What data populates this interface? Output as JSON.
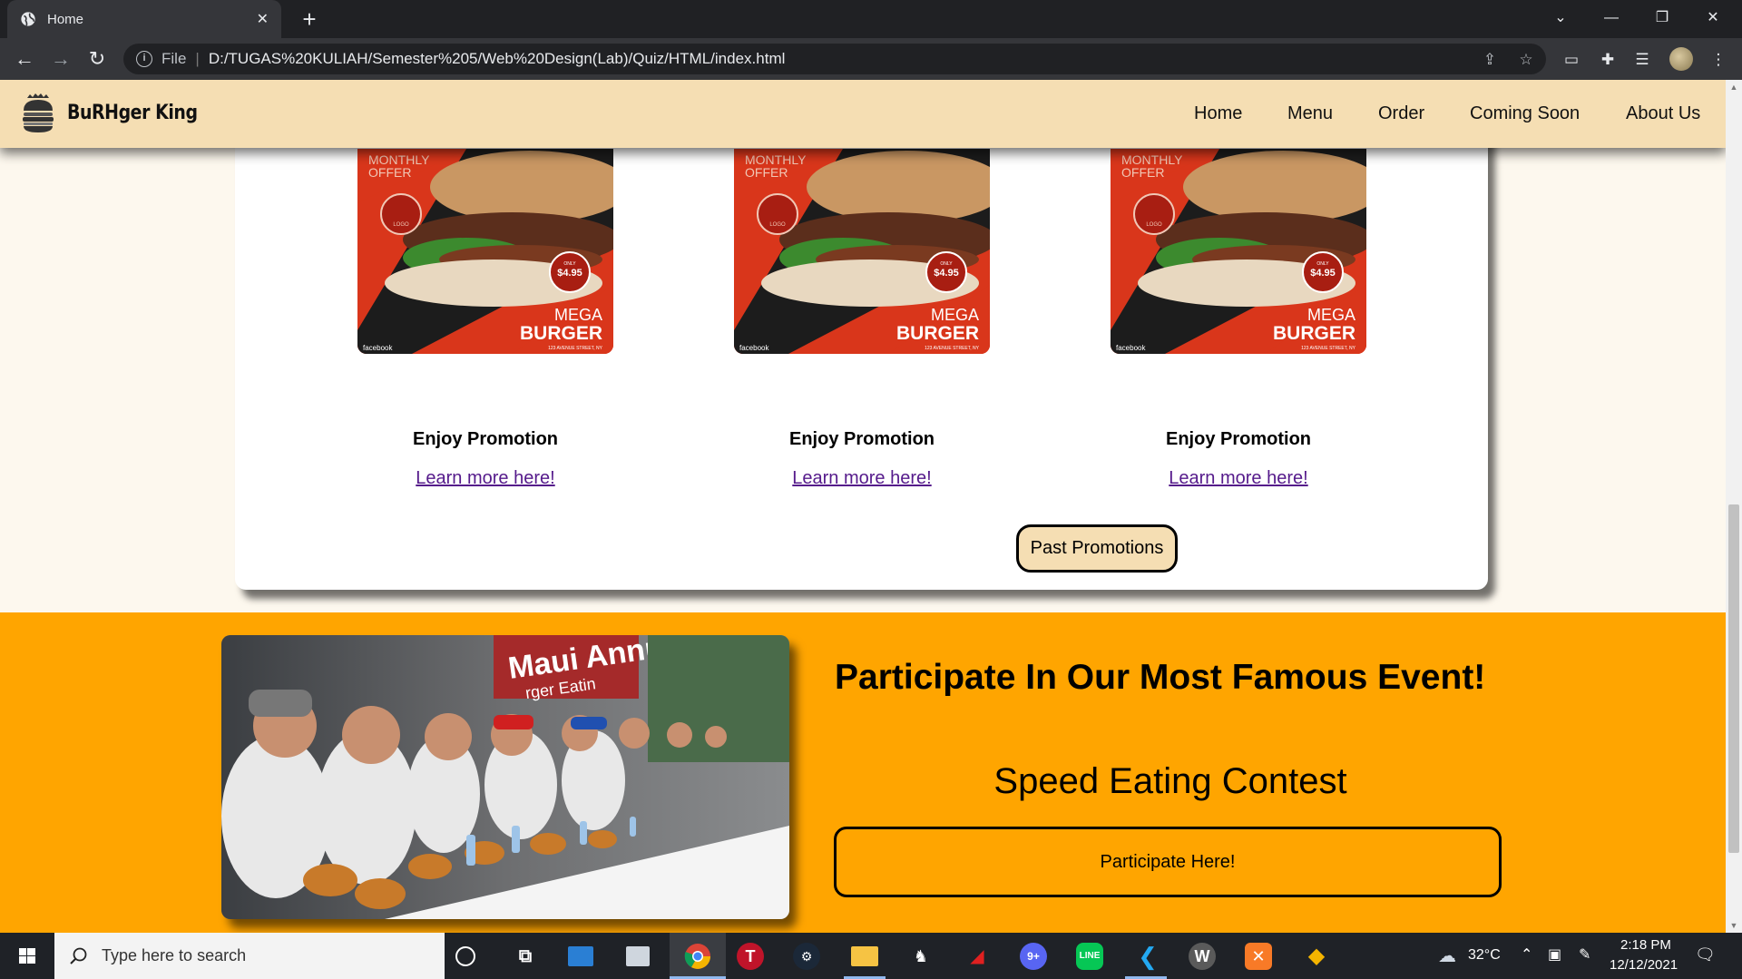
{
  "browser": {
    "tab_title": "Home",
    "tab_close": "✕",
    "new_tab": "+",
    "address_file_label": "File",
    "address_url": "D:/TUGAS%20KULIAH/Semester%205/Web%20Design(Lab)/Quiz/HTML/index.html",
    "window_controls": {
      "minimize": "—",
      "restore": "❐",
      "close": "✕",
      "tab_search": "⌄"
    }
  },
  "site": {
    "brand": "BuRHger King",
    "nav": [
      "Home",
      "Menu",
      "Order",
      "Coming Soon",
      "About Us"
    ]
  },
  "promotions": {
    "items": [
      {
        "title": "Enjoy Promotion",
        "link": "Learn more here!",
        "image": {
          "top_text": "MONTHLY",
          "top_text2": "OFFER",
          "price_small": "ONLY",
          "price": "$4.95",
          "name1": "MEGA",
          "name2": "BURGER",
          "address": "123 AVENUE STREET, NY",
          "social": "facebook",
          "logo": "LOGO"
        }
      },
      {
        "title": "Enjoy Promotion",
        "link": "Learn more here!",
        "image": {
          "top_text": "MONTHLY",
          "top_text2": "OFFER",
          "price_small": "ONLY",
          "price": "$4.95",
          "name1": "MEGA",
          "name2": "BURGER",
          "address": "123 AVENUE STREET, NY",
          "social": "facebook",
          "logo": "LOGO"
        }
      },
      {
        "title": "Enjoy Promotion",
        "link": "Learn more here!",
        "image": {
          "top_text": "MONTHLY",
          "top_text2": "OFFER",
          "price_small": "ONLY",
          "price": "$4.95",
          "name1": "MEGA",
          "name2": "BURGER",
          "address": "123 AVENUE STREET, NY",
          "social": "facebook",
          "logo": "LOGO"
        }
      }
    ],
    "past_button": "Past Promotions"
  },
  "event": {
    "heading": "Participate In Our Most Famous Event!",
    "subheading": "Speed Eating Contest",
    "button": "Participate Here!",
    "photo_banner_text": "Maui Annual",
    "photo_banner_text2": "rger Eatin"
  },
  "taskbar": {
    "search_placeholder": "Type here to search",
    "weather": "32°C",
    "time": "2:18 PM",
    "date": "12/12/2021",
    "apps": [
      "cortana",
      "task-view",
      "contacts",
      "photos",
      "chrome",
      "t-app",
      "steam",
      "file-explorer",
      "media-app",
      "red-app",
      "discord",
      "line",
      "vscode",
      "w-app",
      "xampp",
      "git"
    ]
  },
  "colors": {
    "nav_bg": "#f5deb3",
    "event_bg": "#ffa500",
    "page_bg": "#fdf8ee",
    "promo_red": "#d9361b",
    "link": "#551a8b"
  }
}
